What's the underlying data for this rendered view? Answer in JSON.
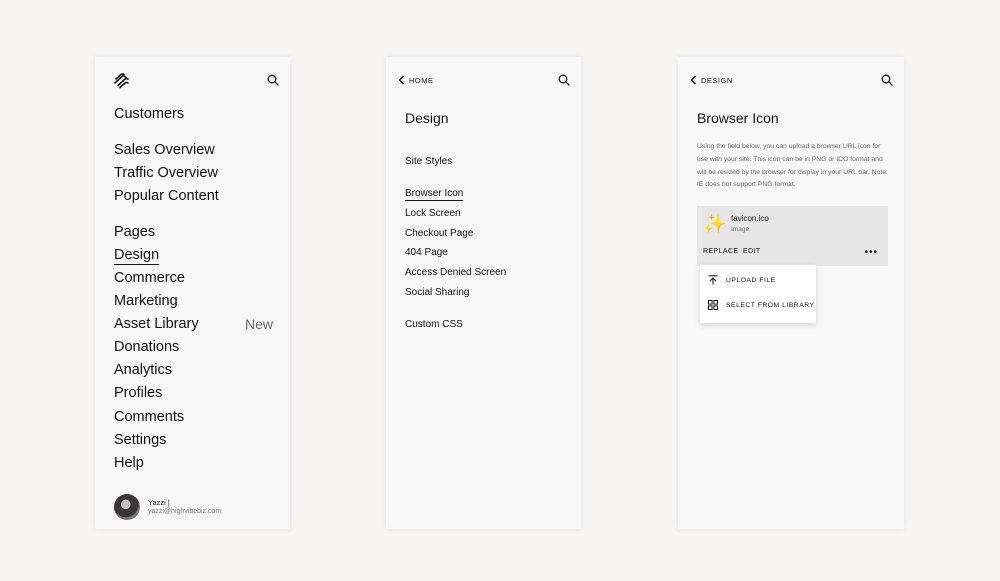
{
  "panel1": {
    "logo_icon": "squarespace-logo-icon",
    "search_icon": "search-icon",
    "items": [
      {
        "label": "Customers"
      },
      {
        "label": "Sales Overview"
      },
      {
        "label": "Traffic Overview"
      },
      {
        "label": "Popular Content"
      },
      {
        "label": "Pages"
      },
      {
        "label": "Design"
      },
      {
        "label": "Commerce"
      },
      {
        "label": "Marketing"
      },
      {
        "label": "Asset Library"
      },
      {
        "label": "Donations"
      },
      {
        "label": "Analytics"
      },
      {
        "label": "Profiles"
      },
      {
        "label": "Comments"
      },
      {
        "label": "Settings"
      },
      {
        "label": "Help"
      }
    ],
    "new_badge": "New",
    "user": {
      "name": "Yazzi |",
      "email": "yazzi@highvibebiz.com"
    }
  },
  "panel2": {
    "back_label": "HOME",
    "title": "Design",
    "items": [
      {
        "label": "Site Styles"
      },
      {
        "label": "Browser Icon"
      },
      {
        "label": "Lock Screen"
      },
      {
        "label": "Checkout Page"
      },
      {
        "label": "404 Page"
      },
      {
        "label": "Access Denied Screen"
      },
      {
        "label": "Social Sharing"
      },
      {
        "label": "Custom CSS"
      }
    ]
  },
  "panel3": {
    "back_label": "DESIGN",
    "title": "Browser Icon",
    "description": "Using the field below, you can upload a browser URL icon for use with your site. This icon can be in PNG or ICO format and will be resized by the browser for display in your URL bar. Note: IE does not support PNG format.",
    "file": {
      "name": "favicon.ico",
      "type": "Image",
      "icon": "sparkle-icon"
    },
    "actions": {
      "replace": "REPLACE",
      "edit": "EDIT",
      "more": "•••"
    },
    "menu": {
      "upload": "UPLOAD FILE",
      "library": "SELECT FROM LIBRARY"
    }
  },
  "colors": {
    "background": "#f6f5f4",
    "panel": "#f8f8f8",
    "card": "#e7e7e7",
    "text": "#111111",
    "muted": "#666666"
  }
}
